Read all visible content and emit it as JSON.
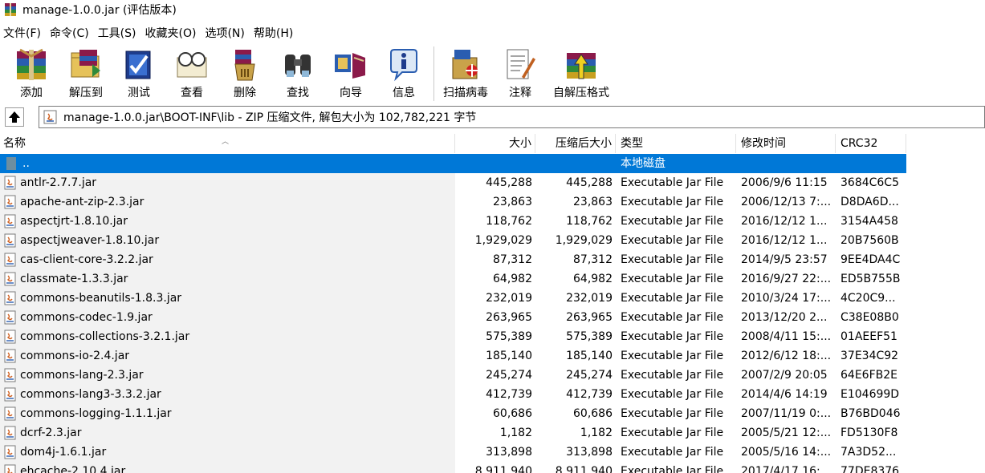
{
  "window": {
    "title": "manage-1.0.0.jar (评估版本)"
  },
  "menu": [
    "文件(F)",
    "命令(C)",
    "工具(S)",
    "收藏夹(O)",
    "选项(N)",
    "帮助(H)"
  ],
  "toolbar": {
    "tools": [
      {
        "label": "添加",
        "icon": "add-archive-icon"
      },
      {
        "label": "解压到",
        "icon": "extract-icon"
      },
      {
        "label": "测试",
        "icon": "test-icon"
      },
      {
        "label": "查看",
        "icon": "view-icon"
      },
      {
        "label": "删除",
        "icon": "delete-icon"
      },
      {
        "label": "查找",
        "icon": "find-icon"
      },
      {
        "label": "向导",
        "icon": "wizard-icon"
      },
      {
        "label": "信息",
        "icon": "info-icon"
      },
      {
        "label": "扫描病毒",
        "icon": "virus-scan-icon"
      },
      {
        "label": "注释",
        "icon": "comment-icon"
      },
      {
        "label": "自解压格式",
        "icon": "sfx-icon"
      }
    ]
  },
  "address": {
    "path": "manage-1.0.0.jar\\BOOT-INF\\lib - ZIP 压缩文件, 解包大小为 102,782,221 字节"
  },
  "columns": {
    "name": "名称",
    "size": "大小",
    "packed": "压缩后大小",
    "type": "类型",
    "modified": "修改时间",
    "crc": "CRC32"
  },
  "parent_row": {
    "name": "..",
    "type": "本地磁盘"
  },
  "files": [
    {
      "name": "antlr-2.7.7.jar",
      "size": "445,288",
      "packed": "445,288",
      "type": "Executable Jar File",
      "modified": "2006/9/6 11:15",
      "crc": "3684C6C5"
    },
    {
      "name": "apache-ant-zip-2.3.jar",
      "size": "23,863",
      "packed": "23,863",
      "type": "Executable Jar File",
      "modified": "2006/12/13 7:...",
      "crc": "D8DA6D..."
    },
    {
      "name": "aspectjrt-1.8.10.jar",
      "size": "118,762",
      "packed": "118,762",
      "type": "Executable Jar File",
      "modified": "2016/12/12 1...",
      "crc": "3154A458"
    },
    {
      "name": "aspectjweaver-1.8.10.jar",
      "size": "1,929,029",
      "packed": "1,929,029",
      "type": "Executable Jar File",
      "modified": "2016/12/12 1...",
      "crc": "20B7560B"
    },
    {
      "name": "cas-client-core-3.2.2.jar",
      "size": "87,312",
      "packed": "87,312",
      "type": "Executable Jar File",
      "modified": "2014/9/5 23:57",
      "crc": "9EE4DA4C"
    },
    {
      "name": "classmate-1.3.3.jar",
      "size": "64,982",
      "packed": "64,982",
      "type": "Executable Jar File",
      "modified": "2016/9/27 22:...",
      "crc": "ED5B755B"
    },
    {
      "name": "commons-beanutils-1.8.3.jar",
      "size": "232,019",
      "packed": "232,019",
      "type": "Executable Jar File",
      "modified": "2010/3/24 17:...",
      "crc": "4C20C9..."
    },
    {
      "name": "commons-codec-1.9.jar",
      "size": "263,965",
      "packed": "263,965",
      "type": "Executable Jar File",
      "modified": "2013/12/20 2...",
      "crc": "C38E08B0"
    },
    {
      "name": "commons-collections-3.2.1.jar",
      "size": "575,389",
      "packed": "575,389",
      "type": "Executable Jar File",
      "modified": "2008/4/11 15:...",
      "crc": "01AEEF51"
    },
    {
      "name": "commons-io-2.4.jar",
      "size": "185,140",
      "packed": "185,140",
      "type": "Executable Jar File",
      "modified": "2012/6/12 18:...",
      "crc": "37E34C92"
    },
    {
      "name": "commons-lang-2.3.jar",
      "size": "245,274",
      "packed": "245,274",
      "type": "Executable Jar File",
      "modified": "2007/2/9 20:05",
      "crc": "64E6FB2E"
    },
    {
      "name": "commons-lang3-3.3.2.jar",
      "size": "412,739",
      "packed": "412,739",
      "type": "Executable Jar File",
      "modified": "2014/4/6 14:19",
      "crc": "E104699D"
    },
    {
      "name": "commons-logging-1.1.1.jar",
      "size": "60,686",
      "packed": "60,686",
      "type": "Executable Jar File",
      "modified": "2007/11/19 0:...",
      "crc": "B76BD046"
    },
    {
      "name": "dcrf-2.3.jar",
      "size": "1,182",
      "packed": "1,182",
      "type": "Executable Jar File",
      "modified": "2005/5/21 12:...",
      "crc": "FD5130F8"
    },
    {
      "name": "dom4j-1.6.1.jar",
      "size": "313,898",
      "packed": "313,898",
      "type": "Executable Jar File",
      "modified": "2005/5/16 14:...",
      "crc": "7A3D52..."
    },
    {
      "name": "ehcache-2.10.4.jar",
      "size": "8,911,940",
      "packed": "8,911,940",
      "type": "Executable Jar File",
      "modified": "2017/4/17 16:...",
      "crc": "77DE8376"
    }
  ]
}
